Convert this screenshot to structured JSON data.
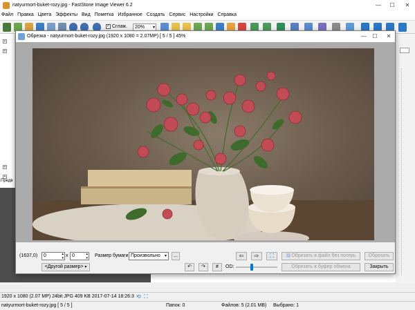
{
  "window": {
    "title": "natyurmort-buket-rozy.jpg  -  FastStone Image Viewer 6.2",
    "min": "—",
    "max": "☐",
    "close": "✕"
  },
  "menu": [
    "Файл",
    "Правка",
    "Цвета",
    "Эффекты",
    "Вид",
    "Пометка",
    "Избранное",
    "Создать",
    "Сервис",
    "Настройки",
    "Справка"
  ],
  "toolbar": {
    "smooth_label": "Сглаж.",
    "zoom_value": "20%"
  },
  "left_label": "Предв",
  "dialog": {
    "title": "Обрезка  -  natyurmort-buket-rozy.jpg  (1920 x 1080 = 2.07MP)  [ 5 / 5 ]  45%",
    "min": "—",
    "max": "☐",
    "close": "✕",
    "coords": "(1637,0)",
    "width_value": "0",
    "x_sep": "x",
    "height_value": "0",
    "paper_label": "Размер бумаги:",
    "paper_value": "Произвольно",
    "ellipsis": "...",
    "other_size": "<Другой размер>",
    "crop_to_file": "Обрезать в файл без потерь",
    "crop": "Обрезать",
    "crop_clipboard": "Обрезать в буфер обмена",
    "close_btn": "Закрыть",
    "od_label": "OD:"
  },
  "statusbar": {
    "info": "1920 x 1080 (2.07 MP)  24bit  JPG   409 KB   2017-07-14 18:26:3",
    "file": "natyurmort-buket-rozy.jpg [ 5 / 5 ]",
    "folders": "Папок: 0",
    "files": "Файлов: 5 (2.01 MB)",
    "selected": "Выбрано: 1"
  },
  "colors": {
    "accent": "#0078d7",
    "rose": "#c24b55",
    "leaf": "#3c6b2c"
  }
}
